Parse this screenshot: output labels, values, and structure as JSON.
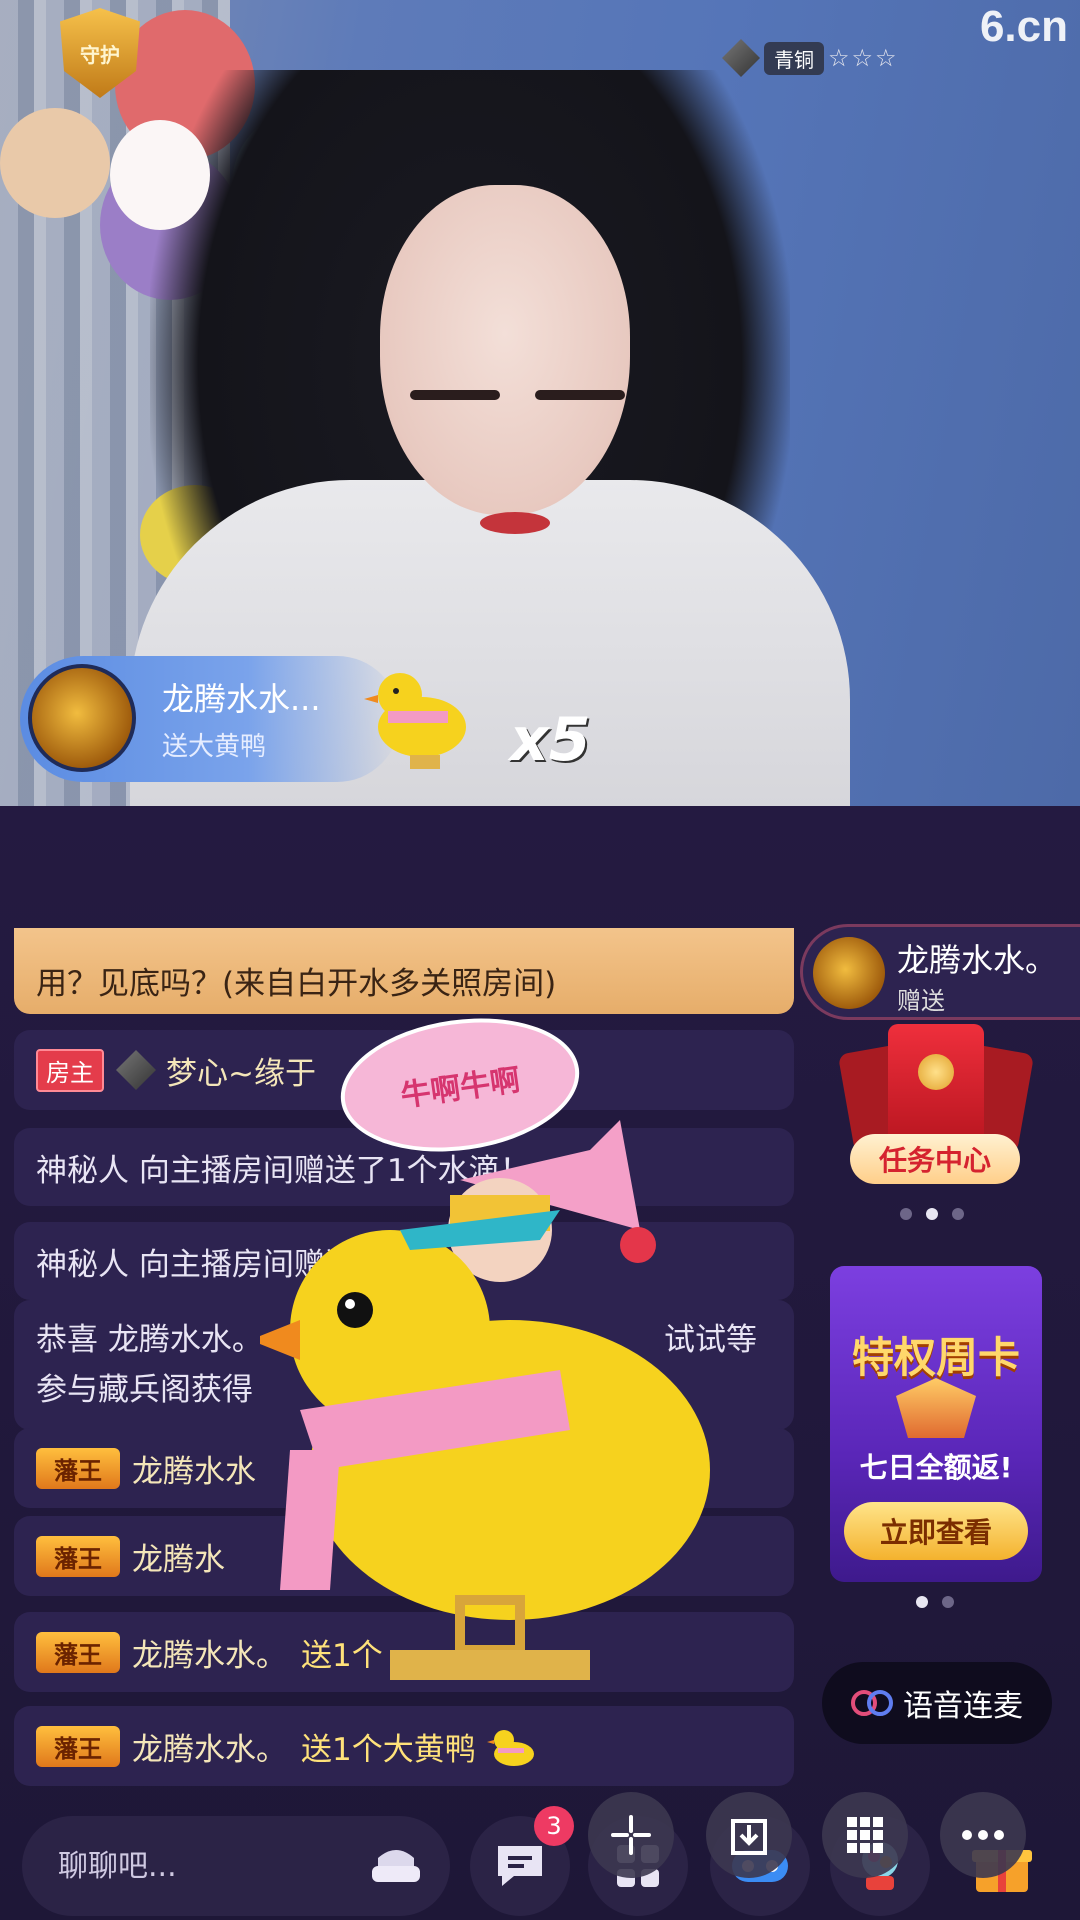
{
  "video": {
    "guard_badge": "守护",
    "logo": "6.cn",
    "rank_label": "青铜",
    "rank_stars": "☆☆☆"
  },
  "gift_banner": {
    "sender": "龙腾水水...",
    "action": "送大黄鸭",
    "count": "x5"
  },
  "chat": {
    "vip_message": "用？见底吗？(来自白开水多关照房间)",
    "host_row": {
      "badge": "房主",
      "name": "梦心~缘于"
    },
    "system_1": "神秘人 向主播房间赠送了1个水滴！",
    "system_2": "神秘人 向主播房间赠送了1个",
    "congrats": "恭喜 龙腾水水。",
    "congrats_line2": "参与藏兵阁获得",
    "congrats_tail": "试试等",
    "king_rows": [
      {
        "badge": "藩王",
        "name": "龙腾水水",
        "gift": ""
      },
      {
        "badge": "藩王",
        "name": "龙腾水",
        "gift": ""
      },
      {
        "badge": "藩王",
        "name": "龙腾水水。",
        "gift": "送1个"
      },
      {
        "badge": "藩王",
        "name": "龙腾水水。",
        "gift": "送1个大黄鸭"
      }
    ]
  },
  "animation_bubble": "牛啊牛啊",
  "side": {
    "gift_sender": "龙腾水水。",
    "gift_action": "赠送",
    "task_label": "任务中心",
    "week_card_title": "特权周卡",
    "week_card_sub": "七日全额返!",
    "week_card_button": "立即查看",
    "voice_link": "语音连麦"
  },
  "bottom": {
    "input_placeholder": "聊聊吧...",
    "message_count": "3"
  },
  "colors": {
    "accent_gold": "#ffe27a",
    "host_badge": "#e43c4b",
    "background": "#221a3f"
  }
}
